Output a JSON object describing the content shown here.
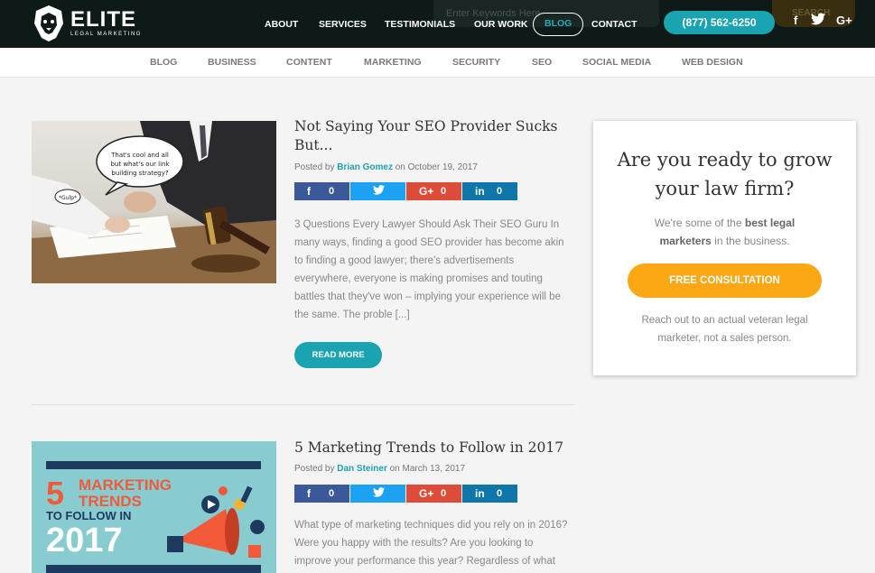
{
  "header": {
    "logo_title": "ELITE",
    "logo_sub": "LEGAL MARKETING",
    "search_placeholder": "Enter Keywords Here",
    "search_button": "SEARCH",
    "nav": [
      {
        "label": "ABOUT"
      },
      {
        "label": "SERVICES"
      },
      {
        "label": "TESTIMONIALS"
      },
      {
        "label": "OUR WORK"
      },
      {
        "label": "BLOG"
      },
      {
        "label": "CONTACT"
      }
    ],
    "phone": "(877) 562-6250",
    "social": [
      {
        "icon": "facebook-icon",
        "glyph": "f"
      },
      {
        "icon": "twitter-icon",
        "glyph": "🐦"
      },
      {
        "icon": "google-plus-icon",
        "glyph": "G+"
      }
    ]
  },
  "categories": [
    "BLOG",
    "BUSINESS",
    "CONTENT",
    "MARKETING",
    "SECURITY",
    "SEO",
    "SOCIAL MEDIA",
    "WEB DESIGN"
  ],
  "posts": [
    {
      "title": "Not Saying Your SEO Provider Sucks But...",
      "posted_by": "Posted by",
      "author": "Brian Gomez",
      "date": "on October 19, 2017",
      "shares": {
        "facebook": "0",
        "google": "0",
        "linkedin": "0"
      },
      "excerpt": "3 Questions Every Lawyer Should Ask Their SEO Guru In many ways, finding a good SEO provider has become akin to finding a good lawyer; there's advertisements everywhere, everyone is making promises and touting battles that they've won – implying your experience will be the same. The proble [...]",
      "read_more": "READ MORE",
      "image_bubble": "That's cool and all but what's our link building strategy?",
      "image_small_bubble": "*Gulp*"
    },
    {
      "title": "5 Marketing Trends to Follow in 2017",
      "posted_by": "Posted by",
      "author": "Dan Steiner",
      "date": "on March 13, 2017",
      "shares": {
        "facebook": "0",
        "google": "0",
        "linkedin": "0"
      },
      "excerpt": "What type of marketing techniques did you rely on in 2016? Were you happy with the results? Are you looking to improve your performance this year? Regardless of what",
      "image_text": {
        "num": "5",
        "line1": "MARKETING",
        "line2": "TRENDS",
        "line3": "TO FOLLOW IN",
        "year": "2017"
      }
    }
  ],
  "sidebar": {
    "heading": "Are you ready to grow your law firm?",
    "text_pre": "We're some of the ",
    "text_bold": "best legal marketers",
    "text_post": " in the business.",
    "button": "FREE CONSULTATION",
    "note": "Reach out to an actual veteran legal marketer, not a sales person."
  },
  "colors": {
    "teal": "#1aa4b2",
    "orange": "#fca814",
    "header": "#0d1a17"
  }
}
